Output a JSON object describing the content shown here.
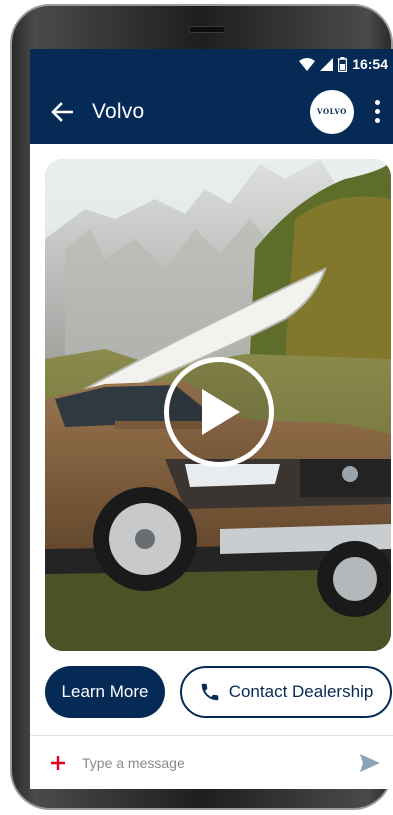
{
  "status_bar": {
    "time": "16:54"
  },
  "app_bar": {
    "title": "Volvo",
    "logo_text": "VOLVO"
  },
  "media": {
    "image": "volvo-xc70-with-kayak"
  },
  "actions": {
    "learn_more": "Learn More",
    "contact_dealership": "Contact Dealership"
  },
  "composer": {
    "placeholder": "Type a message"
  },
  "colors": {
    "brand_navy": "#062a56",
    "accent_red": "#e2001a",
    "send_grey": "#8fa3b8"
  }
}
